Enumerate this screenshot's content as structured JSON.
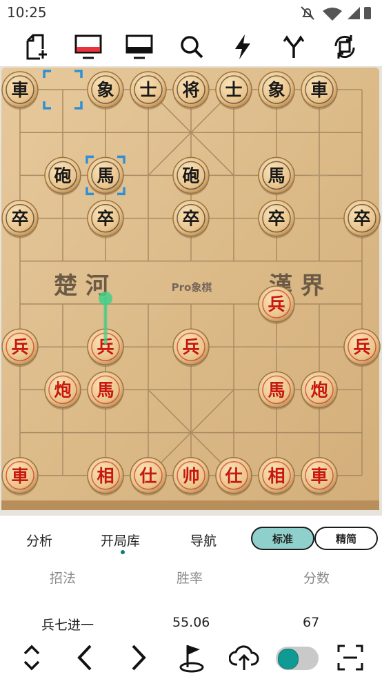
{
  "status": {
    "time": "10:25"
  },
  "toolbar": {
    "items": [
      {
        "name": "new-game-icon"
      },
      {
        "name": "red-side-icon"
      },
      {
        "name": "black-side-icon"
      },
      {
        "name": "search-icon"
      },
      {
        "name": "lightning-icon"
      },
      {
        "name": "branch-icon"
      },
      {
        "name": "flip-board-icon"
      }
    ]
  },
  "board": {
    "river_left": "楚 河",
    "river_center": "Pro象棋",
    "river_right": "漢 界",
    "black_pieces": [
      {
        "t": "車",
        "c": 0,
        "r": 0
      },
      {
        "t": "象",
        "c": 2,
        "r": 0
      },
      {
        "t": "士",
        "c": 3,
        "r": 0
      },
      {
        "t": "将",
        "c": 4,
        "r": 0
      },
      {
        "t": "士",
        "c": 5,
        "r": 0
      },
      {
        "t": "象",
        "c": 6,
        "r": 0
      },
      {
        "t": "車",
        "c": 7,
        "r": 0
      },
      {
        "t": "砲",
        "c": 1,
        "r": 2
      },
      {
        "t": "馬",
        "c": 2,
        "r": 2
      },
      {
        "t": "砲",
        "c": 4,
        "r": 2
      },
      {
        "t": "馬",
        "c": 6,
        "r": 2
      },
      {
        "t": "卒",
        "c": 0,
        "r": 3
      },
      {
        "t": "卒",
        "c": 2,
        "r": 3
      },
      {
        "t": "卒",
        "c": 4,
        "r": 3
      },
      {
        "t": "卒",
        "c": 6,
        "r": 3
      },
      {
        "t": "卒",
        "c": 8,
        "r": 3
      }
    ],
    "red_pieces": [
      {
        "t": "兵",
        "c": 6,
        "r": 5
      },
      {
        "t": "兵",
        "c": 0,
        "r": 6
      },
      {
        "t": "兵",
        "c": 2,
        "r": 6
      },
      {
        "t": "兵",
        "c": 4,
        "r": 6
      },
      {
        "t": "兵",
        "c": 8,
        "r": 6
      },
      {
        "t": "炮",
        "c": 1,
        "r": 7
      },
      {
        "t": "馬",
        "c": 2,
        "r": 7
      },
      {
        "t": "馬",
        "c": 6,
        "r": 7
      },
      {
        "t": "炮",
        "c": 7,
        "r": 7
      },
      {
        "t": "車",
        "c": 0,
        "r": 9
      },
      {
        "t": "相",
        "c": 2,
        "r": 9
      },
      {
        "t": "仕",
        "c": 3,
        "r": 9
      },
      {
        "t": "帅",
        "c": 4,
        "r": 9
      },
      {
        "t": "仕",
        "c": 5,
        "r": 9
      },
      {
        "t": "相",
        "c": 6,
        "r": 9
      },
      {
        "t": "車",
        "c": 7,
        "r": 9
      }
    ],
    "selection_marks": [
      {
        "c": 1,
        "r": 0
      },
      {
        "c": 2,
        "r": 2
      }
    ],
    "move_arrow": {
      "from": {
        "c": 2,
        "r": 5
      },
      "to": {
        "c": 2,
        "r": 6
      }
    }
  },
  "tabs": {
    "analysis": "分析",
    "opening_book": "开局库",
    "navigation": "导航",
    "standard": "标准",
    "compact": "精简"
  },
  "table": {
    "headers": [
      "招法",
      "胜率",
      "分数"
    ],
    "rows": [
      [
        "兵七进一",
        "55.06",
        "67"
      ]
    ]
  },
  "bottom": {
    "items": [
      "expand-collapse-icon",
      "prev-icon",
      "next-icon",
      "flag-icon",
      "upload-icon",
      "toggle-switch",
      "scan-icon"
    ],
    "toggle_on": true
  },
  "colors": {
    "accent": "#0f9a94",
    "red_piece": "#c8170d",
    "black_piece": "#1a1a1a",
    "selection": "#2e8fd8"
  }
}
